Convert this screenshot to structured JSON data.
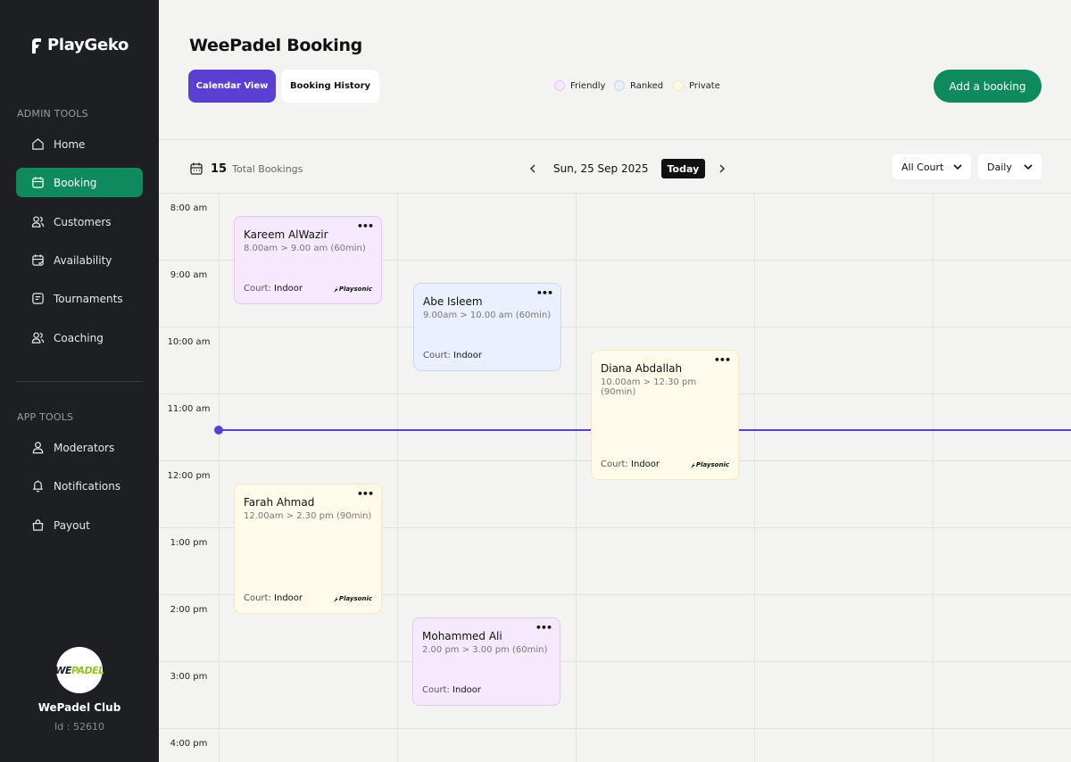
{
  "sidebar": {
    "brand": "PlayGeko",
    "admin_label": "ADMIN TOOLS",
    "app_label": "APP TOOLS",
    "admin_items": [
      {
        "label": "Home",
        "icon": "home-icon"
      },
      {
        "label": "Booking",
        "icon": "calendar-icon",
        "active": true
      },
      {
        "label": "Customers",
        "icon": "users-icon"
      },
      {
        "label": "Availability",
        "icon": "calendar-check-icon"
      },
      {
        "label": "Tournaments",
        "icon": "trophy-icon"
      },
      {
        "label": "Coaching",
        "icon": "coach-icon"
      }
    ],
    "app_items": [
      {
        "label": "Moderators",
        "icon": "user-icon"
      },
      {
        "label": "Notifications",
        "icon": "bell-icon"
      },
      {
        "label": "Payout",
        "icon": "bag-icon"
      }
    ],
    "club": {
      "avatar_text_a": "WE",
      "avatar_text_b": "PADEL",
      "name": "WePadel Club",
      "id": "Id : 52610"
    }
  },
  "header": {
    "title": "WeePadel Booking",
    "tabs": [
      "Calendar View",
      "Booking History"
    ],
    "legend": [
      {
        "label": "Friendly",
        "color": "#f7e9fd",
        "border": "#e3c8f2"
      },
      {
        "label": "Ranked",
        "color": "#eaf0ff",
        "border": "#c9d6f5"
      },
      {
        "label": "Private",
        "color": "#fefbea",
        "border": "#f3e9bd"
      }
    ],
    "add_button": "Add a booking"
  },
  "toolbar": {
    "total_count": "15",
    "total_label": "Total Bookings",
    "date": "Sun, 25 Sep 2025",
    "today": "Today",
    "court_filter": "All Court",
    "view_filter": "Daily"
  },
  "calendar": {
    "times": [
      "8:00 am",
      "9:00 am",
      "10:00 am",
      "11:00 am",
      "12:00 pm",
      "1:00 pm",
      "2:00 pm",
      "3:00 pm",
      "4:00 pm"
    ],
    "bookings": [
      {
        "name": "Kareem AlWazir",
        "time": "8.00am > 9.00 am (60min)",
        "court_label": "Court:",
        "court": "Indoor",
        "type": "pink",
        "brand": "Playsonic"
      },
      {
        "name": "Abe Isleem",
        "time": "9.00am > 10.00 am (60min)",
        "court_label": "Court:",
        "court": "Indoor",
        "type": "blue"
      },
      {
        "name": "Diana Abdallah",
        "time": "10.00am > 12.30 pm (90min)",
        "court_label": "Court:",
        "court": "Indoor",
        "type": "yellow",
        "brand": "Playsonic"
      },
      {
        "name": "Farah Ahmad",
        "time": "12.00am > 2.30 pm (90min)",
        "court_label": "Court:",
        "court": "Indoor",
        "type": "yellow",
        "brand": "Playsonic"
      },
      {
        "name": "Mohammed Ali",
        "time": "2.00 pm > 3.00 pm (60min)",
        "court_label": "Court:",
        "court": "Indoor",
        "type": "pink"
      }
    ]
  }
}
